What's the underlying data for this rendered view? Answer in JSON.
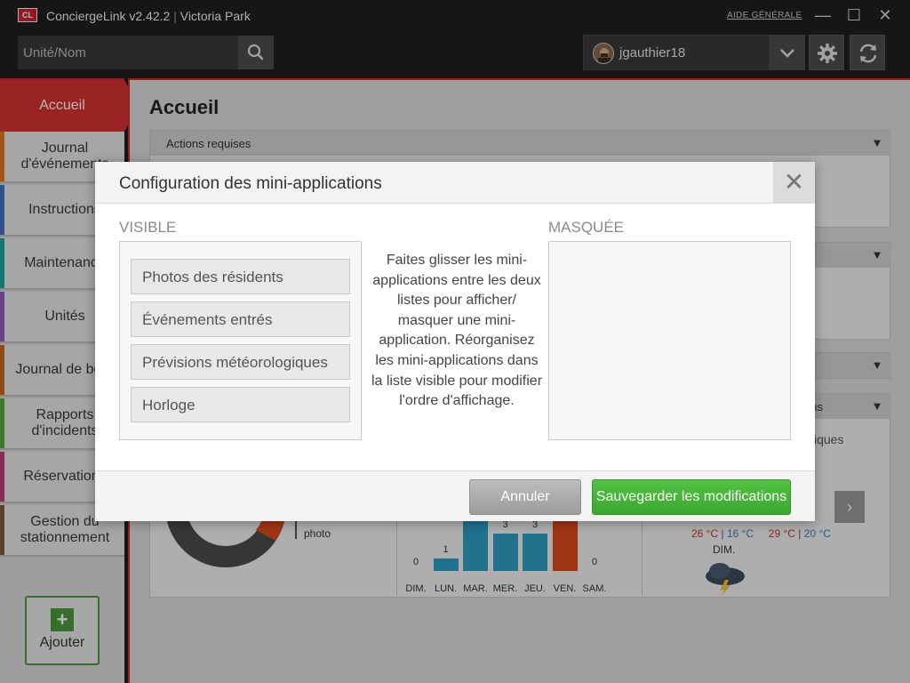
{
  "app": {
    "logo": "CL",
    "name": "ConciergeLink v2.42.2",
    "separator": "|",
    "property": "Victoria Park",
    "help_link": "AIDE GÉNÉRALE"
  },
  "window_controls": {
    "minimize": "—",
    "maximize": "☐",
    "close": "✕"
  },
  "search": {
    "placeholder": "Unité/Nom"
  },
  "user": {
    "username": "jgauthier18"
  },
  "sidebar": {
    "active": "Accueil",
    "items": [
      {
        "line1": "Journal",
        "line2": "d'événements",
        "color": "#e07b1d"
      },
      {
        "line1": "Instructions",
        "line2": "",
        "color": "#4a6fc4"
      },
      {
        "line1": "Maintenance",
        "line2": "",
        "color": "#1aa79c"
      },
      {
        "line1": "Unités",
        "line2": "",
        "color": "#8e5cc4"
      },
      {
        "line1": "Journal de bord",
        "line2": "",
        "color": "#c46a22"
      },
      {
        "line1": "Rapports",
        "line2": "d'incidents",
        "color": "#5aa83c"
      },
      {
        "line1": "Réservations",
        "line2": "",
        "color": "#c43c7a"
      },
      {
        "line1": "Gestion du",
        "line2": "stationnement",
        "color": "#7a5a3c"
      }
    ],
    "add_label": "Ajouter"
  },
  "main": {
    "title": "Accueil",
    "panel_actions": "Actions requises",
    "panel_fragment": "lications",
    "weather_fragment": "iques",
    "legend_fragment": "photo",
    "weather": {
      "hi1": "26 °C",
      "lo1": "16 °C",
      "hi2": "29 °C",
      "lo2": "20 °C",
      "sep": "|",
      "day": "DIM."
    }
  },
  "chart_data": {
    "type": "bar",
    "categories": [
      "DIM.",
      "LUN.",
      "MAR.",
      "MER.",
      "JEU.",
      "VEN.",
      "SAM."
    ],
    "values": [
      0,
      1,
      null,
      3,
      3,
      null,
      0
    ],
    "value_labels": [
      "0",
      "1",
      "",
      "3",
      "3",
      "",
      "0"
    ],
    "ylim": [
      0,
      6
    ]
  },
  "modal": {
    "title": "Configuration des mini-applications",
    "close": "✕",
    "visible_title": "VISIBLE",
    "hidden_title": "MASQUÉE",
    "visible_items": [
      "Photos des résidents",
      "Événements entrés",
      "Prévisions météorologiques",
      "Horloge"
    ],
    "help_text": "Faites glisser les mini-applications entre les deux listes pour afficher/ masquer une mini-application. Réorganisez les mini-applications dans la liste visible pour modifier l'ordre d'affichage.",
    "cancel_label": "Annuler",
    "save_label": "Sauvegarder les modifications"
  },
  "colors": {
    "accent": "#d63131",
    "save": "#3aa82e",
    "bar": "#2d9fc4",
    "bar_alt": "#de4a1c"
  }
}
